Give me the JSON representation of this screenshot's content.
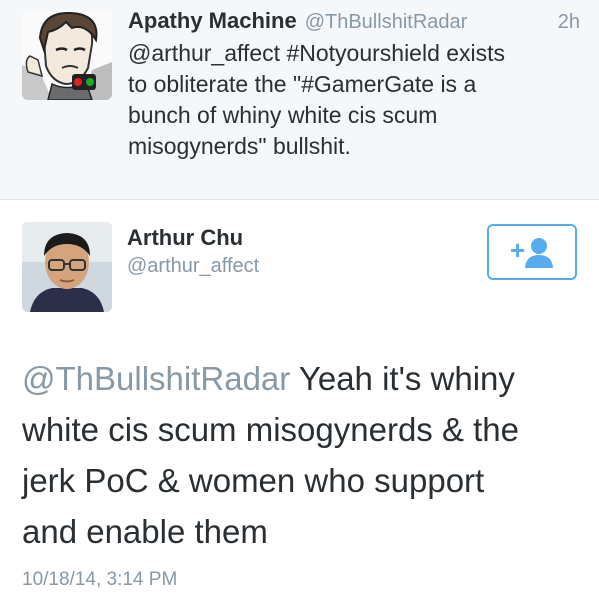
{
  "reply_tweet": {
    "name": "Apathy Machine",
    "handle": "@ThBullshitRadar",
    "time": "2h",
    "text_lines": [
      "@arthur_affect #Notyourshield exists",
      "to obliterate the \"#GamerGate is a",
      "bunch of whiny white cis scum",
      "misogynerds\" bullshit."
    ],
    "avatar_icon": "cartoon-avatar-icon"
  },
  "main_tweet": {
    "name": "Arthur Chu",
    "handle": "@arthur_affect",
    "follow_icon": "add-user-icon",
    "follow_plus": "+",
    "mention": "@ThBullshitRadar",
    "text_lines": [
      " Yeah it's whiny",
      "white cis scum misogynerds & the",
      "jerk PoC & women who support",
      "and enable them"
    ],
    "date": "10/18/14, 3:14 PM",
    "avatar_icon": "profile-photo-icon"
  },
  "colors": {
    "accent": "#55acee",
    "muted": "#8899a6",
    "text": "#292f33",
    "reply_bg": "#f5f8fa"
  }
}
